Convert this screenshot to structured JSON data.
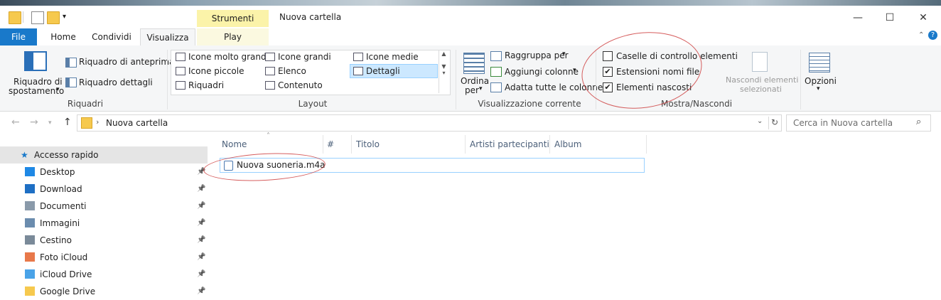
{
  "window": {
    "title": "Nuova cartella",
    "contextual_tab_group": "Strumenti musica",
    "minimize": "—",
    "maximize": "☐",
    "close": "✕"
  },
  "tabs": {
    "file": "File",
    "home": "Home",
    "share": "Condividi",
    "view": "Visualizza",
    "play": "Play"
  },
  "ribbon": {
    "riquadri": {
      "nav_pane_line1": "Riquadro di",
      "nav_pane_line2": "spostamento",
      "preview": "Riquadro di anteprima",
      "details": "Riquadro dettagli",
      "label": "Riquadri"
    },
    "layout": {
      "items": [
        "Icone molto grandi",
        "Icone grandi",
        "Icone medie",
        "Icone piccole",
        "Elenco",
        "Dettagli",
        "Riquadri",
        "Contenuto"
      ],
      "selected": "Dettagli",
      "label": "Layout"
    },
    "current_view": {
      "sort_line1": "Ordina",
      "sort_line2": "per",
      "group_by": "Raggruppa per",
      "add_columns": "Aggiungi colonne",
      "fit_columns": "Adatta tutte le colonne",
      "label": "Visualizzazione corrente"
    },
    "show_hide": {
      "checkboxes_label": "Caselle di controllo elementi",
      "checkboxes_checked": false,
      "extensions_label": "Estensioni nomi file",
      "extensions_checked": true,
      "hidden_label": "Elementi nascosti",
      "hidden_checked": true,
      "hide_selected_line1": "Nascondi elementi",
      "hide_selected_line2": "selezionati",
      "label": "Mostra/Nascondi"
    },
    "options": {
      "label": "Opzioni"
    }
  },
  "address": {
    "path": "Nuova cartella",
    "search_placeholder": "Cerca in Nuova cartella"
  },
  "nav_pane": {
    "items": [
      {
        "label": "Accesso rapido",
        "icon": "star-icon"
      },
      {
        "label": "Desktop",
        "icon": "desktop-icon"
      },
      {
        "label": "Download",
        "icon": "download-icon"
      },
      {
        "label": "Documenti",
        "icon": "documents-icon"
      },
      {
        "label": "Immagini",
        "icon": "pictures-icon"
      },
      {
        "label": "Cestino",
        "icon": "recycle-bin-icon"
      },
      {
        "label": "Foto iCloud",
        "icon": "icloud-photos-icon"
      },
      {
        "label": "iCloud Drive",
        "icon": "icloud-drive-icon"
      },
      {
        "label": "Google Drive",
        "icon": "folder-icon"
      }
    ]
  },
  "file_list": {
    "columns": [
      "Nome",
      "#",
      "Titolo",
      "Artisti partecipanti",
      "Album"
    ],
    "rows": [
      {
        "name": "Nuova suoneria.m4a"
      }
    ]
  },
  "colors": {
    "file_tab": "#1979ca",
    "contextual_tab": "#fbf3a9",
    "selection": "#cce8ff",
    "annotation": "#c82828"
  }
}
